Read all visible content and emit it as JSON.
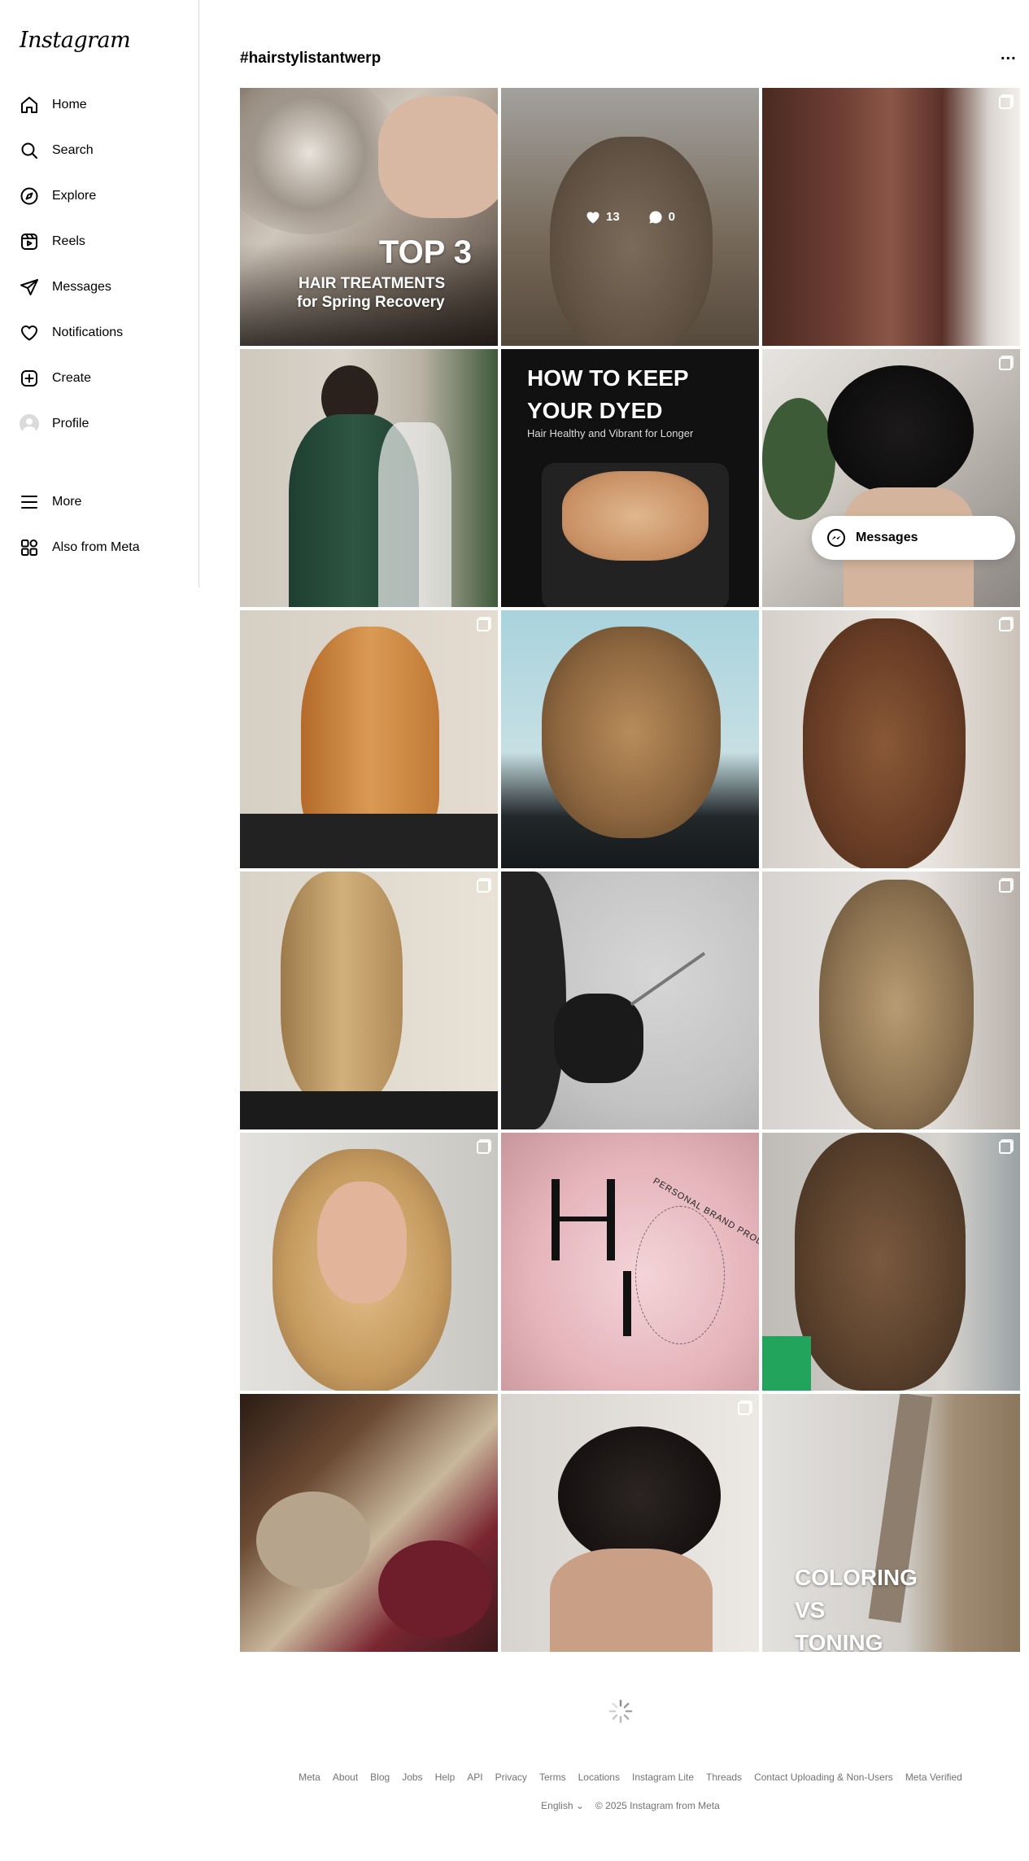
{
  "app": {
    "logo_text": "Instagram"
  },
  "sidebar": {
    "items": [
      {
        "label": "Home",
        "icon": "home-icon"
      },
      {
        "label": "Search",
        "icon": "search-icon"
      },
      {
        "label": "Explore",
        "icon": "compass-icon"
      },
      {
        "label": "Reels",
        "icon": "reels-icon"
      },
      {
        "label": "Messages",
        "icon": "paper-plane-icon"
      },
      {
        "label": "Notifications",
        "icon": "heart-icon"
      },
      {
        "label": "Create",
        "icon": "plus-square-icon"
      },
      {
        "label": "Profile",
        "icon": "avatar"
      },
      {
        "label": "More",
        "icon": "menu-icon"
      },
      {
        "label": "Also from Meta",
        "icon": "meta-apps-icon"
      }
    ]
  },
  "header": {
    "title": "#hairstylistantwerp",
    "more_label": "..."
  },
  "posts": [
    {
      "caption_big": "TOP 3",
      "caption_line1": "HAIR TREATMENTS",
      "caption_line2": "for Spring Recovery",
      "multi": false
    },
    {
      "likes": "13",
      "comments": "0",
      "hovered": true,
      "multi": false
    },
    {
      "multi": true
    },
    {
      "multi": false
    },
    {
      "caption_line1": "HOW TO KEEP",
      "caption_line2": "YOUR DYED",
      "caption_sub": "Hair Healthy and Vibrant for Longer",
      "multi": false
    },
    {
      "multi": true
    },
    {
      "multi": true
    },
    {
      "multi": false
    },
    {
      "multi": true
    },
    {
      "multi": true
    },
    {
      "multi": false
    },
    {
      "multi": true
    },
    {
      "multi": true
    },
    {
      "brand_letters": "H I",
      "brand_ring": "PERSONAL BRAND PRODUCTS",
      "multi": false
    },
    {
      "multi": true
    },
    {
      "multi": false
    },
    {
      "multi": true
    },
    {
      "caption_line1": "COLORING",
      "caption_line2": "VS",
      "caption_line3": "TONING",
      "multi": false
    }
  ],
  "floating_messages": {
    "label": "Messages",
    "icon": "messenger-icon"
  },
  "footer": {
    "links": [
      "Meta",
      "About",
      "Blog",
      "Jobs",
      "Help",
      "API",
      "Privacy",
      "Terms",
      "Locations",
      "Instagram Lite",
      "Threads",
      "Contact Uploading & Non-Users",
      "Meta Verified"
    ],
    "language": "English",
    "copyright": "© 2025 Instagram from Meta"
  }
}
